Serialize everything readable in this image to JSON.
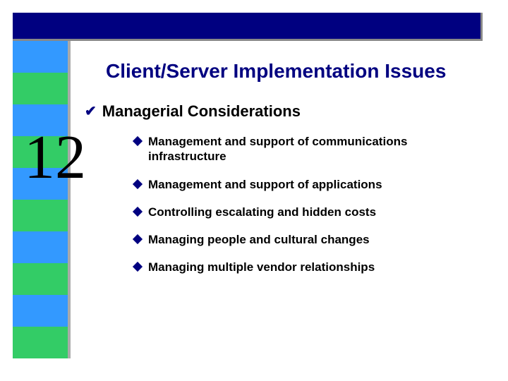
{
  "chapter_number": "12",
  "title": "Client/Server Implementation Issues",
  "subhead": "Managerial Considerations",
  "bullets": [
    "Management and support of communications infrastructure",
    "Management and support of applications",
    "Controlling escalating and hidden costs",
    "Managing people and cultural changes",
    "Managing multiple vendor relationships"
  ],
  "colors": {
    "navy": "#000080",
    "stripe_blue": "#3399ff",
    "stripe_green": "#33cc66"
  }
}
